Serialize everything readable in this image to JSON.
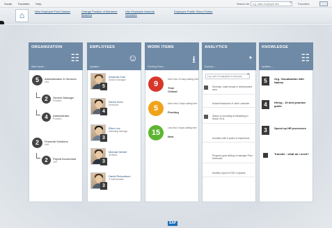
{
  "topbar": {
    "menu": [
      "Social",
      "Favorites",
      "Help"
    ],
    "search_label": "Search for",
    "search_placeholder": "e.g. sales employee dee",
    "favorites_label": "Favorites"
  },
  "navbar": {
    "tabs": [
      "New Employee First Classes",
      "Change Position of Marianne Beaufort",
      "Hire Employee Amanda Schlueter",
      "Employee Profile Simon Parker"
    ]
  },
  "columns": {
    "organization": {
      "title": "ORGANIZATION",
      "sub": "Work Items ..."
    },
    "employees": {
      "title": "EMPLOYEES",
      "sub": "Updates ..."
    },
    "work_items": {
      "title": "WORK ITEMS",
      "sub": "Pending Rows ..."
    },
    "analytics": {
      "title": "ANALYTICS",
      "sub": "Explorer ..."
    },
    "knowledge": {
      "title": "KNOWLEDGE",
      "sub": "Updates ..."
    }
  },
  "organization": [
    {
      "count": "5",
      "label": "Administration & Services",
      "type": "Unit"
    },
    {
      "count": "2",
      "label": "Service Manager",
      "type": "Position"
    },
    {
      "count": "4",
      "label": "Administrator",
      "type": "Position"
    },
    {
      "count": "2",
      "label": "Financial Solutions",
      "type": "Unit"
    },
    {
      "count": "2",
      "label": "Payroll Accountant",
      "type": "Job"
    }
  ],
  "employees": [
    {
      "name": "Amanda Cole",
      "role": "Solution Manager",
      "badge": "5"
    },
    {
      "name": "Derek Irons",
      "role": "Developer",
      "badge": "4"
    },
    {
      "name": "Ellen Lee",
      "role": "Marketing Manager",
      "badge": "3"
    },
    {
      "name": "Michael Winter",
      "role": "Architect",
      "badge": "3"
    },
    {
      "name": "David Richardson",
      "role": "IT Administrator",
      "badge": "3"
    }
  ],
  "work_items": [
    {
      "count": "9",
      "text": "More than 10 days waiting time",
      "label": "Time Critical",
      "color": "#d8362a"
    },
    {
      "count": "5",
      "text": "More than 3 days waiting time",
      "label": "Pending",
      "color": "#f0a31a"
    },
    {
      "count": "15",
      "text": "Less than 3 days waiting time",
      "label": "New",
      "color": "#5cb531"
    }
  ],
  "analytics": {
    "search_placeholder": "e.g. cost of employees in last year",
    "items": [
      "Diversity: male female in development area",
      "Actual headcount of Jane Lavender",
      "Status of recruiting at Marketing in March 2011",
      "Architect with 5 years of experience",
      "Progress goal setting of manager Paul Demester",
      "Monthly report of GSC requests"
    ]
  },
  "knowledge": [
    {
      "count": "5",
      "text": "Org. Visualization with Nakisa"
    },
    {
      "count": "4",
      "text": "Hiring - 10 best practice guide"
    },
    {
      "count": "3",
      "text": "Speed up HR processes"
    },
    {
      "count": "",
      "text": "Transfer - what do I need?"
    }
  ],
  "footer": {
    "logo": "SAP"
  }
}
